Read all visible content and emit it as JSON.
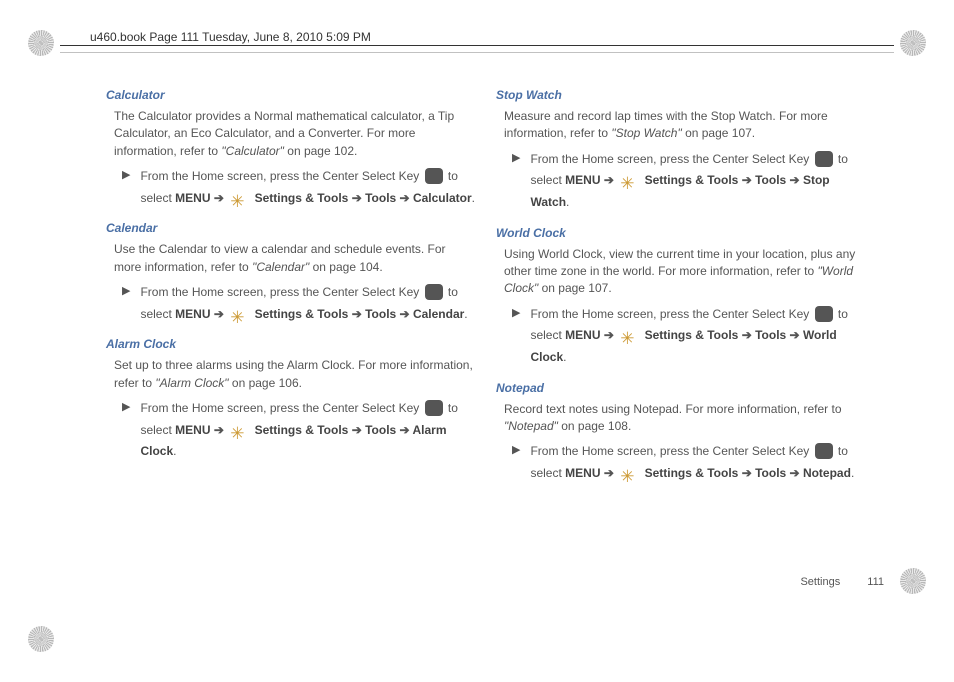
{
  "header": "u460.book  Page 111  Tuesday, June 8, 2010  5:09 PM",
  "footer": {
    "section": "Settings",
    "page": "111"
  },
  "common": {
    "step_prefix": "From the Home screen, press the Center Select Key ",
    "to_select": " to select ",
    "menu": "MENU",
    "arrow": " ➔ ",
    "settings_tools": " Settings & Tools",
    "tools": "Tools"
  },
  "sections": [
    {
      "title": "Calculator",
      "desc_pre": "The Calculator provides a Normal mathematical calculator, a Tip Calculator, an Eco Calculator, and a Converter. For more information, refer to ",
      "desc_link": "\"Calculator\"",
      "desc_post": "  on page 102.",
      "target": "Calculator"
    },
    {
      "title": "Calendar",
      "desc_pre": "Use the Calendar to view a calendar and schedule events. For more information, refer to ",
      "desc_link": "\"Calendar\"",
      "desc_post": "  on page 104.",
      "target": "Calendar"
    },
    {
      "title": "Alarm Clock",
      "desc_pre": "Set up to three alarms using the Alarm Clock. For more information, refer to ",
      "desc_link": "\"Alarm Clock\"",
      "desc_post": "  on page 106.",
      "target": "Alarm Clock"
    },
    {
      "title": "Stop Watch",
      "desc_pre": "Measure and record lap times with the Stop Watch. For more information, refer to ",
      "desc_link": "\"Stop Watch\"",
      "desc_post": "  on page 107.",
      "target": "Stop Watch"
    },
    {
      "title": "World Clock",
      "desc_pre": "Using World Clock, view the current time in your location, plus any other time zone in the world. For more information, refer to ",
      "desc_link": "\"World Clock\"",
      "desc_post": "  on page 107.",
      "target": "World Clock"
    },
    {
      "title": "Notepad",
      "desc_pre": "Record text notes using Notepad. For more information, refer to ",
      "desc_link": "\"Notepad\"",
      "desc_post": "  on page 108.",
      "target": "Notepad"
    }
  ]
}
